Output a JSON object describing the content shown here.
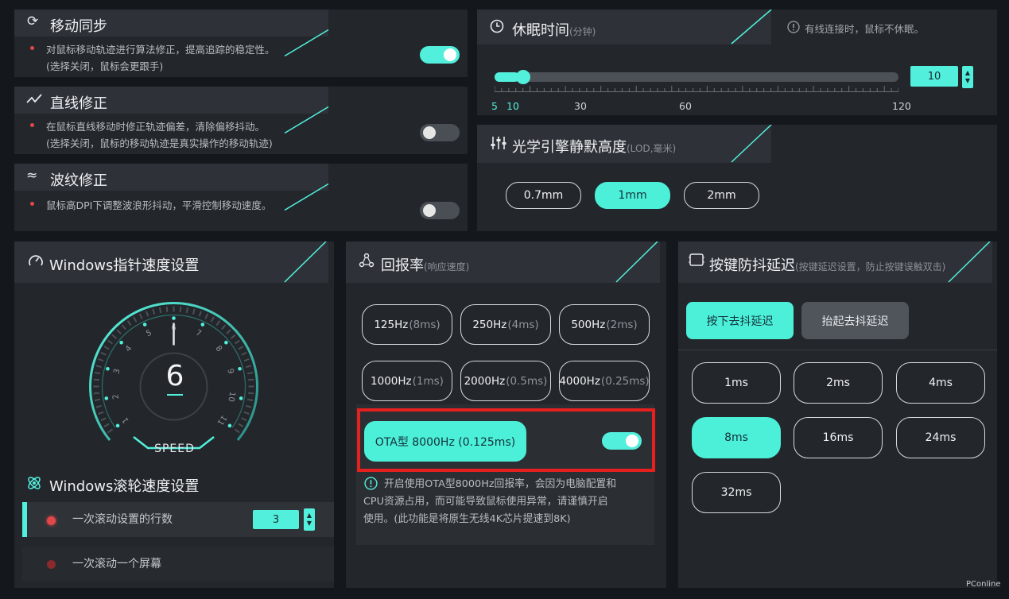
{
  "motion_sync": {
    "title": "移动同步",
    "desc1": "对鼠标移动轨迹进行算法修正，提高追踪的稳定性。",
    "desc2": "(选择关闭，鼠标会更跟手)",
    "enabled": true
  },
  "angle_snap": {
    "title": "直线修正",
    "desc1": "在鼠标直线移动时修正轨迹偏差，清除偏移抖动。",
    "desc2": "(选择关闭，鼠标的移动轨迹是真实操作的移动轨迹)",
    "enabled": false
  },
  "ripple": {
    "title": "波纹修正",
    "desc1": "鼠标高DPI下调整波浪形抖动，平滑控制移动速度。",
    "enabled": false
  },
  "sleep": {
    "title": "休眠时间",
    "unit": "(分钟)",
    "note": "有线连接时，鼠标不休眠。",
    "value": "10",
    "value_num": 10,
    "min": 5,
    "max": 120,
    "ticks": [
      "5",
      "10",
      "30",
      "60",
      "120"
    ]
  },
  "lod": {
    "title": "光学引擎静默高度",
    "unit": "(LOD,毫米)",
    "options": [
      "0.7mm",
      "1mm",
      "2mm"
    ],
    "selected": 1
  },
  "pointer_speed": {
    "title": "Windows指针速度设置",
    "value": "6",
    "speed_label": "SPEED",
    "dial_numbers": [
      "1",
      "2",
      "3",
      "4",
      "5",
      "6",
      "7",
      "8",
      "9",
      "10",
      "11"
    ]
  },
  "scroll": {
    "title": "Windows滚轮速度设置",
    "lines_label": "一次滚动设置的行数",
    "lines_value": "3",
    "screen_label": "一次滚动一个屏幕"
  },
  "polling": {
    "title": "回报率",
    "subtitle": "(响应速度)",
    "options": [
      {
        "main": "125Hz",
        "sub": "(8ms)"
      },
      {
        "main": "250Hz",
        "sub": "(4ms)"
      },
      {
        "main": "500Hz",
        "sub": "(2ms)"
      },
      {
        "main": "1000Hz",
        "sub": "(1ms)"
      },
      {
        "main": "2000Hz",
        "sub": "(0.5ms)"
      },
      {
        "main": "4000Hz",
        "sub": "(0.25ms)"
      }
    ],
    "ota_label": "OTA型 8000Hz (0.125ms)",
    "ota_enabled": true,
    "note1": "开启使用OTA型8000Hz回报率，会因为电脑配置和",
    "note2": "CPU资源占用，而可能导致鼠标使用异常，请谨慎开启",
    "note3": "使用。(此功能是将原生无线4K芯片提速到8K)"
  },
  "debounce": {
    "title": "按键防抖延迟",
    "subtitle": "(按键延迟设置，防止按键误触双击)",
    "tab_press": "按下去抖延迟",
    "tab_release": "抬起去抖延迟",
    "options": [
      "1ms",
      "2ms",
      "4ms",
      "8ms",
      "16ms",
      "24ms",
      "32ms"
    ],
    "selected": 3
  },
  "watermark": "PConline",
  "colors": {
    "accent": "#52f0dc",
    "panel": "#23272c",
    "header": "#2e3238",
    "highlight_box": "#e5201f",
    "bullet": "#e2474a"
  }
}
